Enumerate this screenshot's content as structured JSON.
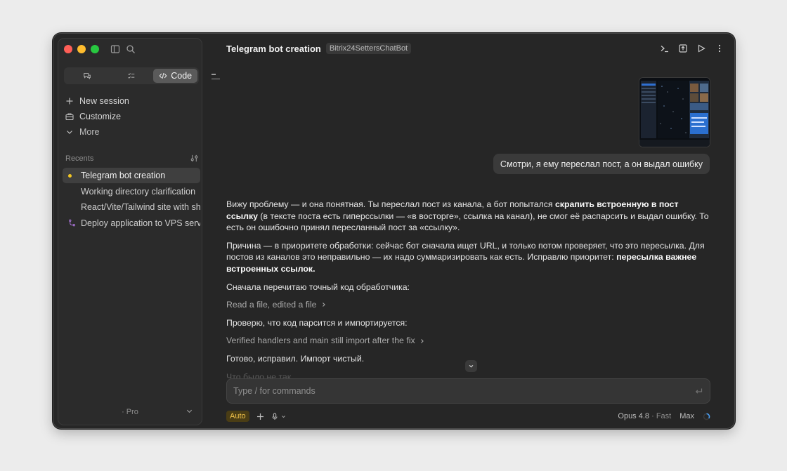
{
  "sidebar": {
    "tabs": [
      {
        "label": ""
      },
      {
        "label": ""
      },
      {
        "label": "Code"
      }
    ],
    "nav": [
      {
        "label": "New session",
        "icon": "plus-icon"
      },
      {
        "label": "Customize",
        "icon": "briefcase-icon"
      },
      {
        "label": "More",
        "icon": "chevron-down-icon"
      }
    ],
    "recents_label": "Recents",
    "recents": [
      {
        "label": "Telegram bot creation",
        "active": true
      },
      {
        "label": "Working directory clarification"
      },
      {
        "label": "React/Vite/Tailwind site with sh"
      },
      {
        "label": "Deploy application to VPS serve"
      }
    ],
    "footer_plan": "· Pro"
  },
  "header": {
    "title": "Telegram bot creation",
    "repo_tag": "Bitrix24SettersChatBot"
  },
  "conversation": {
    "user_message": "Смотри,  я ему переслал пост, а он выдал ошибку",
    "p1_a": "Вижу проблему — и она понятная. Ты переслал пост из канала, а бот попытался ",
    "p1_b": "скрапить встроенную в пост ссылку",
    "p1_c": " (в тексте поста есть гиперссылки — «в восторге», ссылка на канал), не смог её распарсить и выдал ошибку. То есть он ошибочно принял пересланный пост за «ссылку».",
    "p2_a": "Причина — в приоритете обработки: сейчас бот сначала ищет URL, и только потом проверяет, что это пересылка. Для постов из каналов это неправильно — их надо суммаризировать как есть. Исправлю приоритет: ",
    "p2_b": "пересылка важнее встроенных ссылок.",
    "p3": "Сначала перечитаю точный код обработчика:",
    "tool1": "Read a file, edited a file",
    "p4": "Проверю, что код парсится и импортируется:",
    "tool2": "Verified handlers and main still import after the fix",
    "p5": "Готово, исправил. Импорт чистый.",
    "p6_faded": "Что было не так"
  },
  "composer": {
    "placeholder": "Type / for commands"
  },
  "bottom": {
    "mode": "Auto",
    "model": "Opus 4.8",
    "speed": "· Fast",
    "effort": "Max"
  },
  "colors": {
    "accent_yellow": "#f3c623",
    "window_bg": "#262626",
    "sidebar_bg": "#2b2b2b"
  }
}
